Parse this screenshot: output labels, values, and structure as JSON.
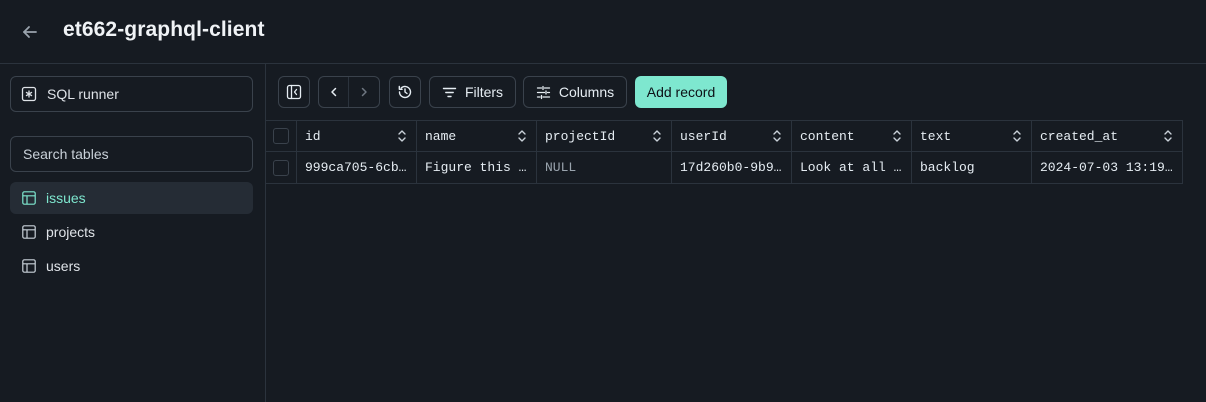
{
  "header": {
    "title": "et662-graphql-client",
    "back_icon": "arrow-left-icon"
  },
  "sidebar": {
    "sql_runner_label": "SQL runner",
    "search_placeholder": "Search tables",
    "tables": [
      {
        "label": "issues",
        "active": true
      },
      {
        "label": "projects",
        "active": false
      },
      {
        "label": "users",
        "active": false
      }
    ]
  },
  "toolbar": {
    "filters_label": "Filters",
    "columns_label": "Columns",
    "add_record_label": "Add record"
  },
  "grid": {
    "columns": [
      "id",
      "name",
      "projectId",
      "userId",
      "content",
      "text",
      "created_at"
    ],
    "rows": [
      [
        "999ca705-6cb…",
        "Figure this …",
        "NULL",
        "17d260b0-9b9…",
        "Look at all …",
        "backlog",
        "2024-07-03 13:19…"
      ]
    ]
  },
  "colors": {
    "accent": "#7ee7cf",
    "background": "#161b22",
    "border": "#2b333d"
  }
}
